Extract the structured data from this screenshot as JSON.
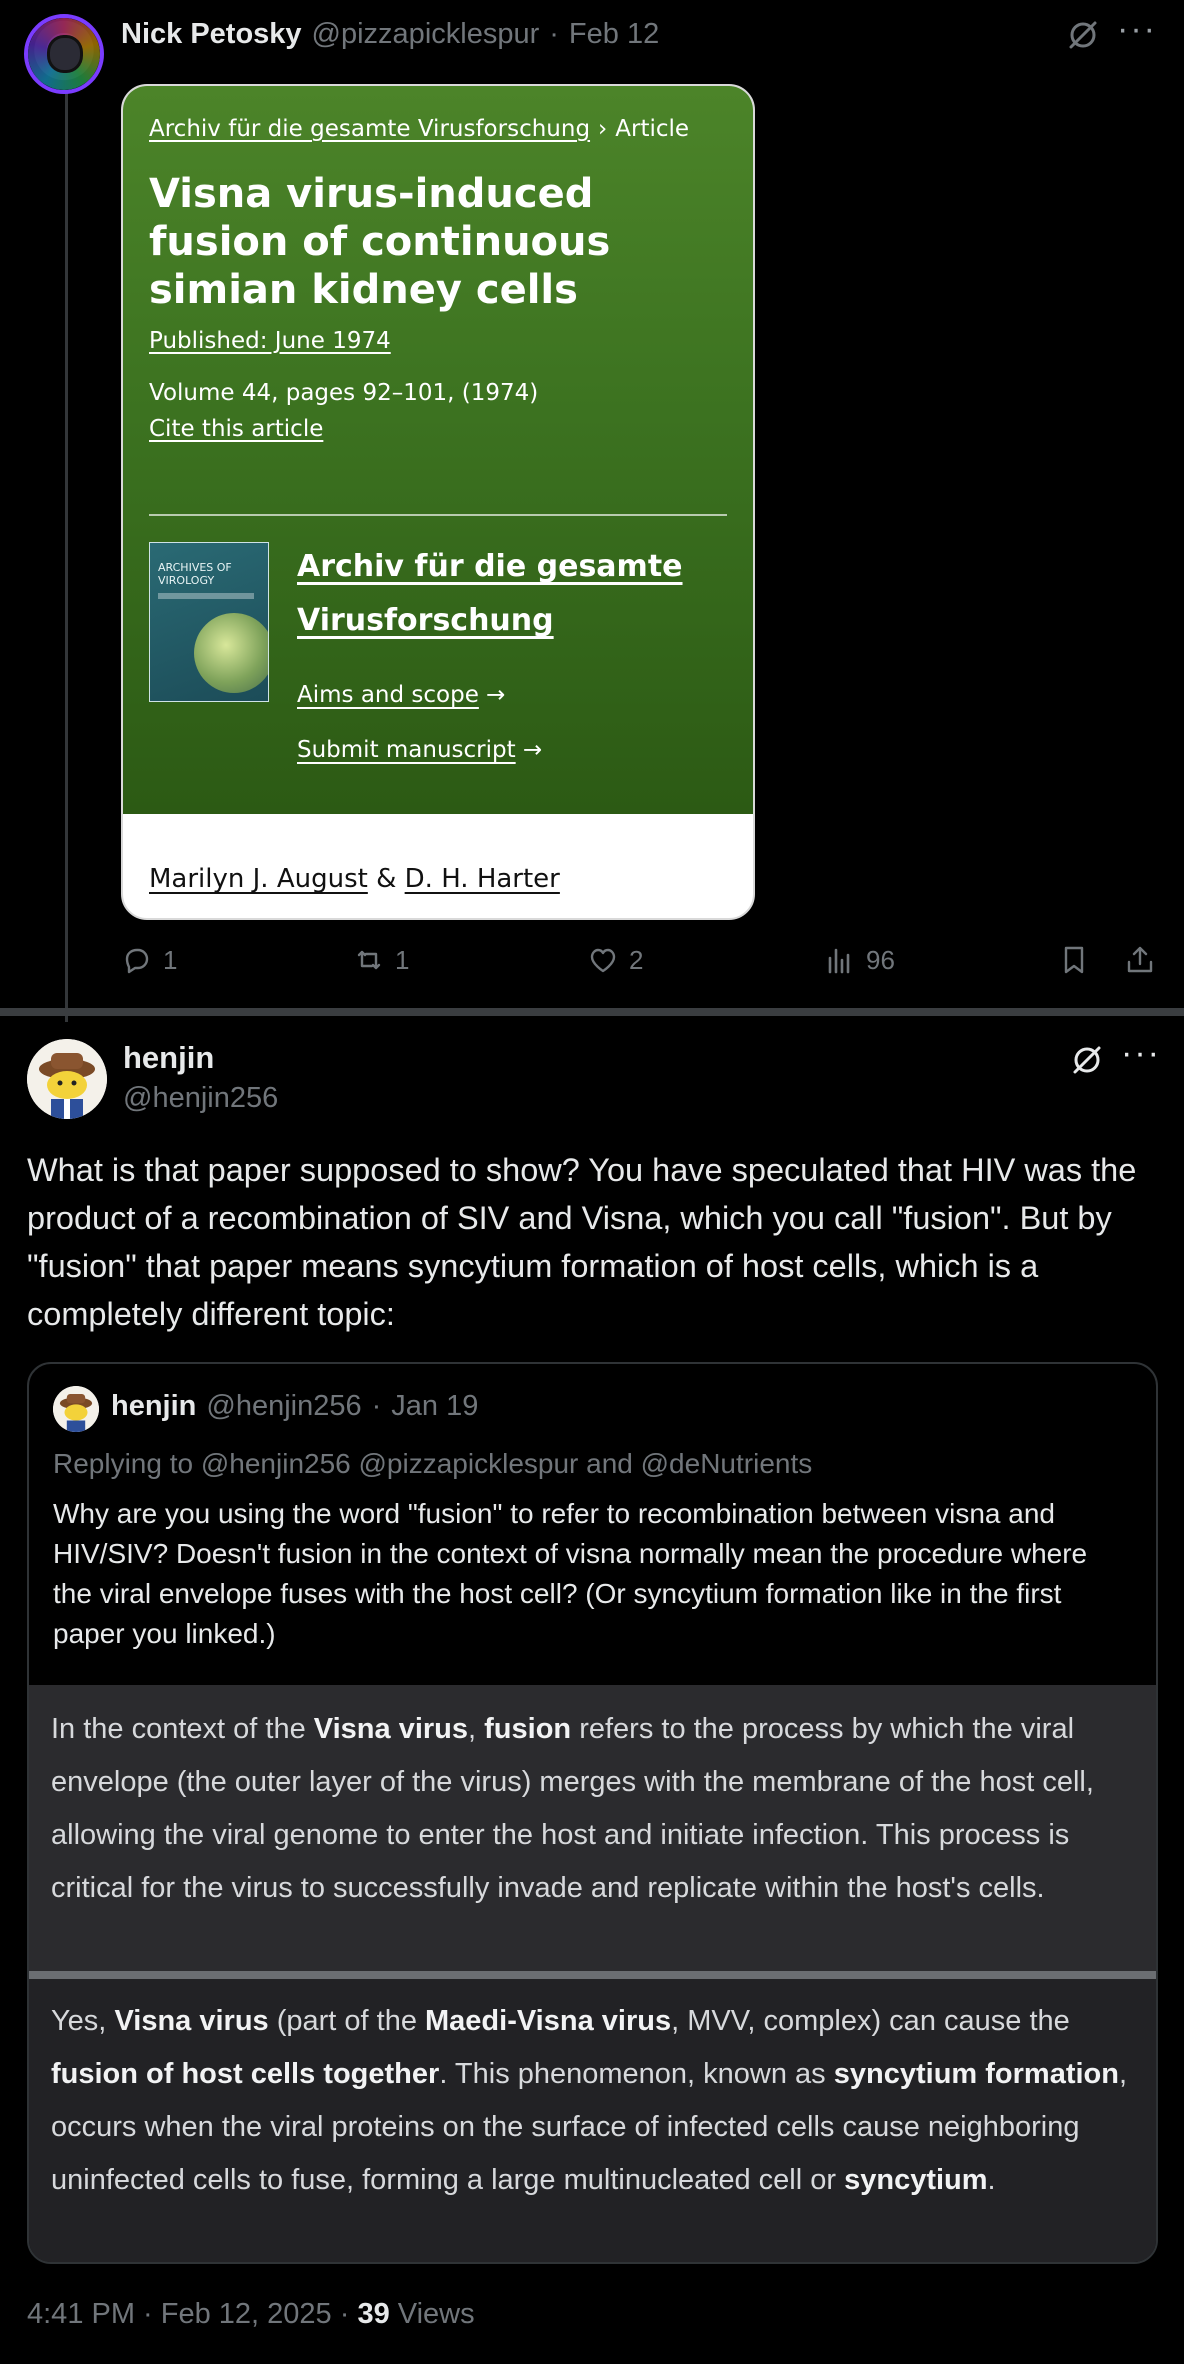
{
  "post1": {
    "name": "Nick Petosky",
    "handle": "@pizzapicklespur",
    "separator": "·",
    "date": "Feb 12",
    "more": "···",
    "card": {
      "breadcrumb_link": "Archiv für die gesamte Virusforschung",
      "breadcrumb_sep": "›",
      "breadcrumb_current": "Article",
      "title": "Visna virus-induced fusion of continuous simian kidney cells",
      "published": "Published: June 1974",
      "volume": "Volume 44, pages 92–101, (1974)",
      "cite": "Cite this article",
      "journal_cover_text": "ARCHIVES OF VIROLOGY",
      "journal_name": "Archiv für die gesamte Virusforschung",
      "aims": "Aims and scope",
      "submit": "Submit manuscript",
      "arrow": "→",
      "author1": "Marilyn J. August",
      "author_join": "&",
      "author2": "D. H. Harter"
    },
    "stats": {
      "replies": "1",
      "reposts": "1",
      "likes": "2",
      "views": "96"
    }
  },
  "post2": {
    "name": "henjin",
    "handle": "@henjin256",
    "more": "···",
    "text": "What is that paper supposed to show? You have speculated that HIV was the product of a recombination of SIV and Visna, which you call \"fusion\". But by \"fusion\" that paper means syncytium formation of host cells, which is a completely different topic:",
    "quote": {
      "name": "henjin",
      "handle": "@henjin256",
      "separator": "·",
      "date": "Jan 19",
      "replying": "Replying to @henjin256 @pizzapicklespur and @deNutrients",
      "text": "Why are you using the word \"fusion\" to refer to recombination between visna and HIV/SIV? Doesn't fusion in the context of visna normally mean the procedure where the viral envelope fuses with the host cell? (Or syncytium formation like in the first paper you linked.)",
      "panel1": {
        "t1": "In the context of the ",
        "b1": "Visna virus",
        "t2": ", ",
        "b2": "fusion",
        "t3": " refers to the process by which the viral envelope (the outer layer of the virus) merges with the membrane of the host cell, allowing the viral genome to enter the host and initiate infection. This process is critical for the virus to successfully invade and replicate within the host's cells."
      },
      "panel2": {
        "t1": "Yes, ",
        "b1": "Visna virus",
        "t2": " (part of the ",
        "b2": "Maedi-Visna virus",
        "t3": ", MVV, complex) can cause the ",
        "b3": "fusion of host cells together",
        "t4": ". This phenomenon, known as ",
        "b4": "syncytium formation",
        "t5": ", occurs when the viral proteins on the surface of infected cells cause neighboring uninfected cells to fuse, forming a large multinucleated cell or ",
        "b5": "syncytium",
        "t6": "."
      }
    },
    "timestamp": "4:41 PM · Feb 12, 2025 · ",
    "views_count": "39",
    "views_label": " Views"
  },
  "icons": {
    "grok": "grok-icon",
    "more": "more-icon",
    "reply": "reply-icon",
    "repost": "repost-icon",
    "like": "heart-icon",
    "views": "analytics-icon",
    "bookmark": "bookmark-icon",
    "share": "share-icon"
  },
  "colors": {
    "background": "#000000",
    "text": "#e7e9ea",
    "muted": "#71767b",
    "card_green": "#3c7220",
    "divider": "#3a3d40"
  }
}
